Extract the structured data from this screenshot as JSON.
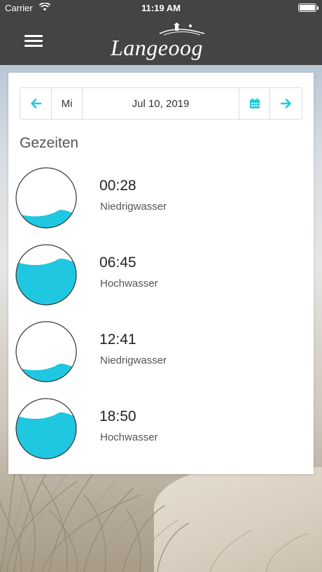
{
  "status": {
    "carrier": "Carrier",
    "time": "11:19 AM"
  },
  "header": {
    "logo_text": "Langeoog"
  },
  "datebar": {
    "weekday": "Mi",
    "date": "Jul 10, 2019"
  },
  "section_title": "Gezeiten",
  "tides": [
    {
      "time": "00:28",
      "label": "Niedrigwasser",
      "level": 0.25
    },
    {
      "time": "06:45",
      "label": "Hochwasser",
      "level": 0.72
    },
    {
      "time": "12:41",
      "label": "Niedrigwasser",
      "level": 0.25
    },
    {
      "time": "18:50",
      "label": "Hochwasser",
      "level": 0.72
    }
  ],
  "colors": {
    "accent": "#1fc7e0",
    "header_bg": "#444447"
  },
  "icons": {
    "prev": "arrow-left-icon",
    "next": "arrow-right-icon",
    "calendar": "calendar-icon",
    "menu": "hamburger-menu-icon"
  }
}
